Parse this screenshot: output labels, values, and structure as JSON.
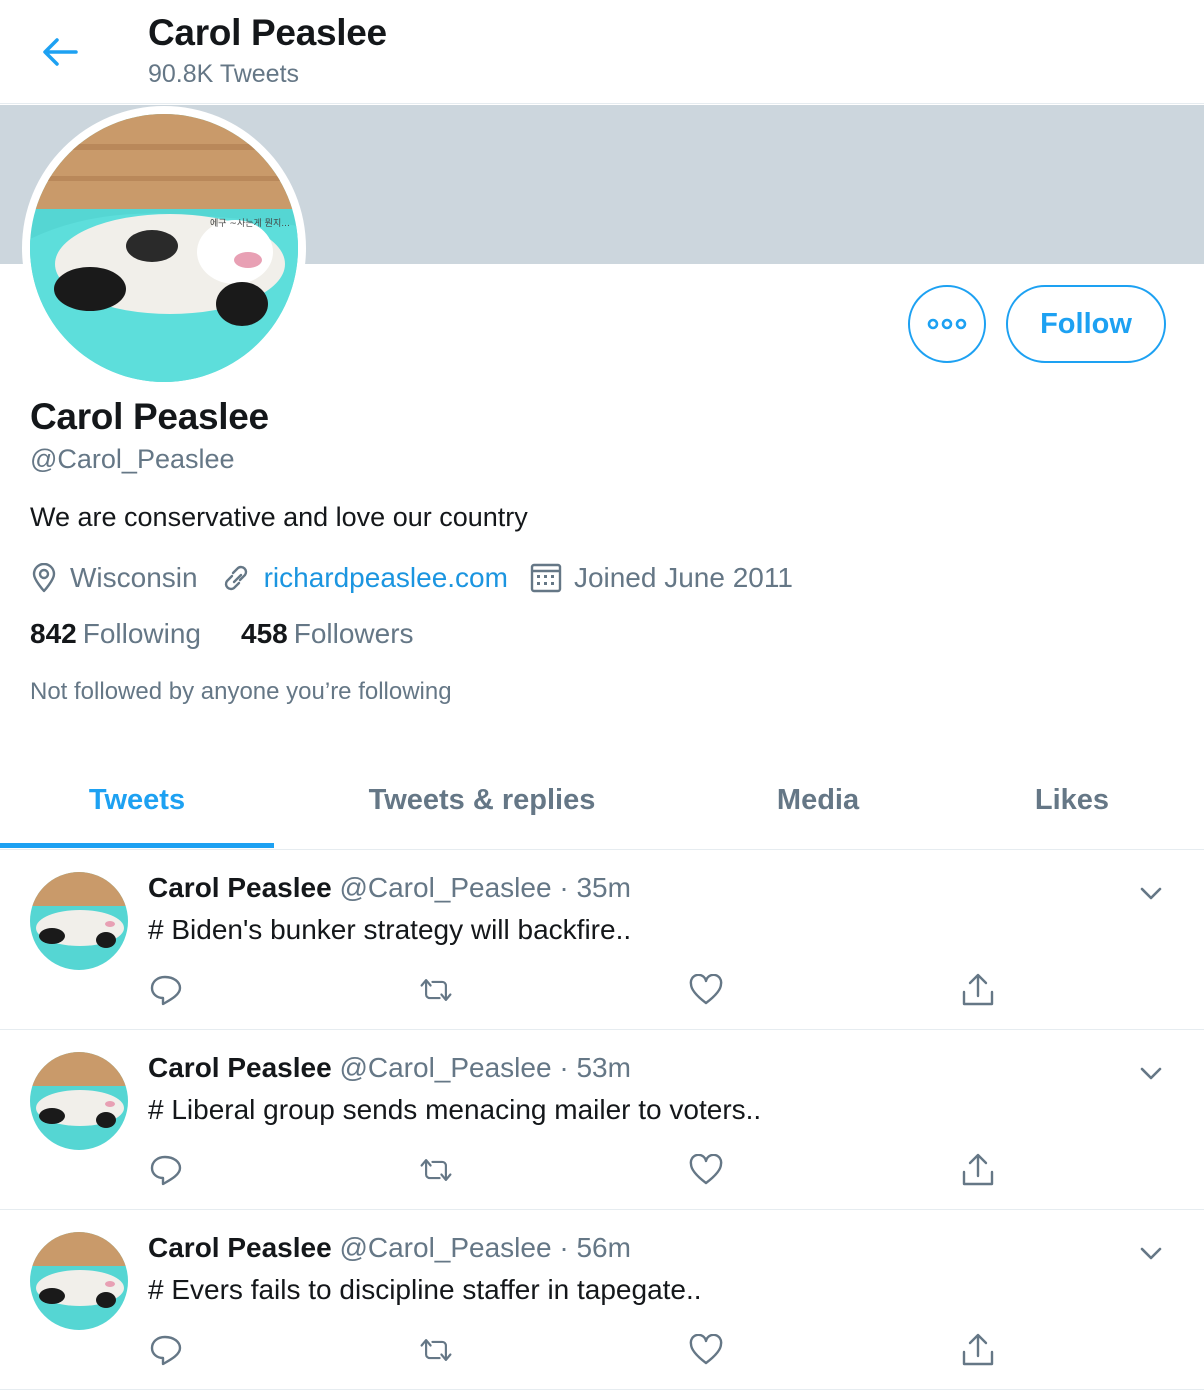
{
  "header": {
    "name": "Carol Peaslee",
    "tweet_count": "90.8K Tweets"
  },
  "profile": {
    "name": "Carol Peaslee",
    "handle": "@Carol_Peaslee",
    "bio": "We are conservative and love our country",
    "location": "Wisconsin",
    "website": "richardpeaslee.com",
    "joined": "Joined June 2011",
    "following_count": "842",
    "following_label": "Following",
    "followers_count": "458",
    "followers_label": "Followers",
    "not_followed": "Not followed by anyone you’re following",
    "avatar_watermark": "에구 ~사는게 뭔지..."
  },
  "buttons": {
    "follow": "Follow"
  },
  "tabs": [
    {
      "label": "Tweets",
      "active": true
    },
    {
      "label": "Tweets & replies",
      "active": false
    },
    {
      "label": "Media",
      "active": false
    },
    {
      "label": "Likes",
      "active": false
    }
  ],
  "tweets": [
    {
      "name": "Carol Peaslee",
      "handle": "@Carol_Peaslee",
      "sep": "·",
      "time": "35m",
      "text": "# Biden's bunker strategy will backfire.."
    },
    {
      "name": "Carol Peaslee",
      "handle": "@Carol_Peaslee",
      "sep": "·",
      "time": "53m",
      "text": "# Liberal group sends menacing mailer to voters.."
    },
    {
      "name": "Carol Peaslee",
      "handle": "@Carol_Peaslee",
      "sep": "·",
      "time": "56m",
      "text": "# Evers fails to discipline staffer in tapegate.."
    }
  ],
  "icons": {
    "back": "arrow-left-icon",
    "more": "more-dots-icon",
    "location": "location-pin-icon",
    "link": "link-icon",
    "calendar": "calendar-icon",
    "caret": "chevron-down-icon",
    "reply": "reply-icon",
    "retweet": "retweet-icon",
    "like": "heart-icon",
    "share": "share-icon"
  },
  "colors": {
    "accent": "#1da1f2",
    "link": "#1b95e0",
    "muted": "#657786",
    "banner": "#ccd6dd",
    "text": "#14171a"
  }
}
